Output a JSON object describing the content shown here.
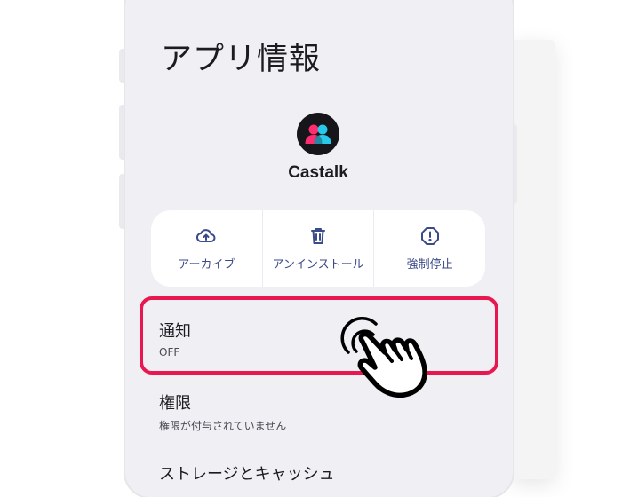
{
  "page": {
    "title": "アプリ情報"
  },
  "app": {
    "name": "Castalk",
    "icon": "castalk-app-icon"
  },
  "actions": [
    {
      "label": "アーカイブ",
      "icon": "cloud-upload-icon"
    },
    {
      "label": "アンインストール",
      "icon": "trash-icon"
    },
    {
      "label": "強制停止",
      "icon": "alert-octagon-icon"
    }
  ],
  "settings": [
    {
      "title": "通知",
      "subtitle": "OFF"
    },
    {
      "title": "権限",
      "subtitle": "権限が付与されていません"
    },
    {
      "title": "ストレージとキャッシュ",
      "subtitle": ""
    }
  ],
  "colors": {
    "highlight": "#e8174f",
    "accent": "#3b4a8a",
    "background": "#f0eff4"
  },
  "overlay": {
    "icon": "tap-hand-icon"
  }
}
